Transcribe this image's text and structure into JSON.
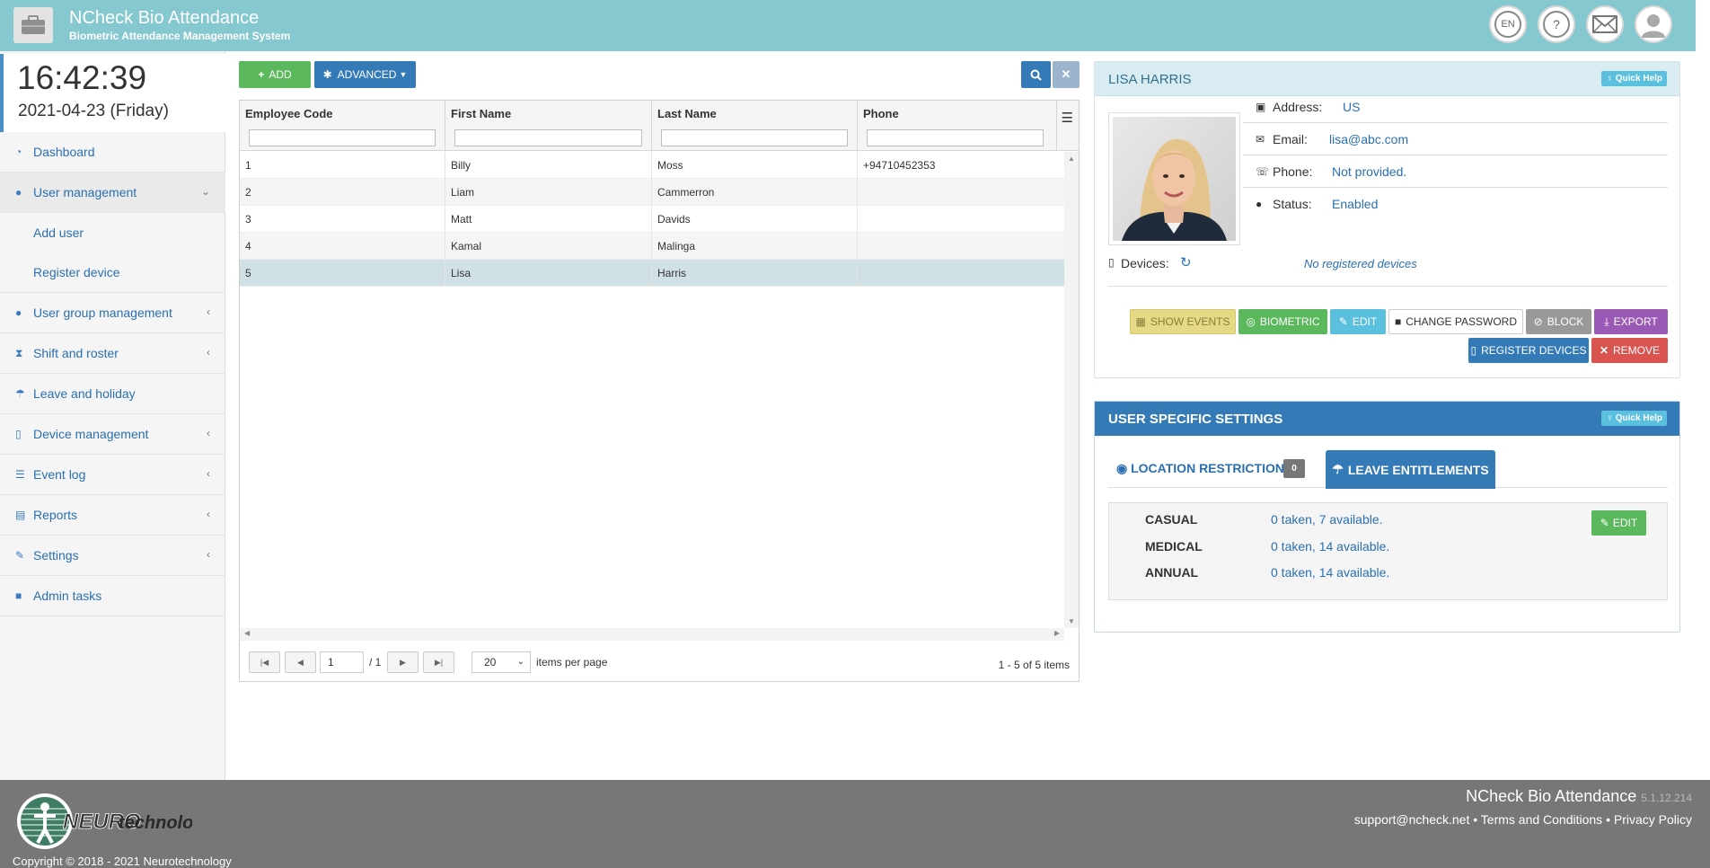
{
  "header": {
    "title": "NCheck Bio Attendance",
    "subtitle": "Biometric Attendance Management System",
    "language": "EN",
    "help_glyph": "?"
  },
  "sidebar": {
    "time": "16:42:39",
    "date": "2021-04-23 (Friday)",
    "items": [
      {
        "label": "Dashboard",
        "icon": "dashboard-icon"
      },
      {
        "label": "User management",
        "icon": "user-icon"
      },
      {
        "label": "User group management",
        "icon": "users-icon"
      },
      {
        "label": "Shift and roster",
        "icon": "hourglass-icon"
      },
      {
        "label": "Leave and holiday",
        "icon": "umbrella-icon"
      },
      {
        "label": "Device management",
        "icon": "mobile-icon"
      },
      {
        "label": "Event log",
        "icon": "list-icon"
      },
      {
        "label": "Reports",
        "icon": "file-icon"
      },
      {
        "label": "Settings",
        "icon": "wrench-icon"
      },
      {
        "label": "Admin tasks",
        "icon": "lock-icon"
      }
    ],
    "subitems": [
      {
        "label": "Add user"
      },
      {
        "label": "Register device"
      }
    ]
  },
  "toolbar": {
    "add_label": "ADD",
    "advanced_label": "ADVANCED"
  },
  "grid": {
    "columns": [
      "Employee Code",
      "First Name",
      "Last Name",
      "Phone"
    ],
    "rows": [
      [
        "1",
        "Billy",
        "Moss",
        "+94710452353"
      ],
      [
        "2",
        "Liam",
        "Cammerron",
        ""
      ],
      [
        "3",
        "Matt",
        "Davids",
        ""
      ],
      [
        "4",
        "Kamal",
        "Malinga",
        ""
      ],
      [
        "5",
        "Lisa",
        "Harris",
        ""
      ]
    ],
    "selected_row": 4,
    "pager": {
      "page": "1",
      "of": "/ 1",
      "page_size": "20",
      "items_per_page": "items per page",
      "info": "1 - 5 of 5 items"
    }
  },
  "profile": {
    "name": "LISA HARRIS",
    "quick_help": "Quick Help",
    "address_label": "Address:",
    "address": "US",
    "email_label": "Email:",
    "email": "lisa@abc.com",
    "phone_label": "Phone:",
    "phone": "Not provided.",
    "status_label": "Status:",
    "status": "Enabled",
    "devices_label": "Devices:",
    "devices": "No registered devices",
    "actions": {
      "show_events": "SHOW EVENTS",
      "biometric": "BIOMETRIC",
      "edit": "EDIT",
      "change_password": "CHANGE PASSWORD",
      "block": "BLOCK",
      "export": "EXPORT",
      "register_devices": "REGISTER DEVICES",
      "remove": "REMOVE"
    }
  },
  "settings": {
    "title": "USER SPECIFIC SETTINGS",
    "quick_help": "Quick Help",
    "tab_location": "LOCATION RESTRICTIONS",
    "tab_location_count": "0",
    "tab_leave": "LEAVE ENTITLEMENTS",
    "edit_label": "EDIT",
    "entitlements": [
      {
        "type": "CASUAL",
        "value": "0 taken, 7 available."
      },
      {
        "type": "MEDICAL",
        "value": "0 taken, 14 available."
      },
      {
        "type": "ANNUAL",
        "value": "0 taken, 14 available."
      }
    ]
  },
  "footer": {
    "app_name": "NCheck Bio Attendance",
    "version": "5.1.12.214",
    "links": "support@ncheck.net • Terms and Conditions • Privacy Policy",
    "copyright": "Copyright © 2018 - 2021 Neurotechnology",
    "logo_text_a": "NEURO",
    "logo_text_b": "technology"
  },
  "colors": {
    "header": "#86c8cf",
    "primary": "#337ab7",
    "success": "#5cb85c",
    "info": "#5bc0de",
    "danger": "#d9534f",
    "footer": "#777777"
  }
}
